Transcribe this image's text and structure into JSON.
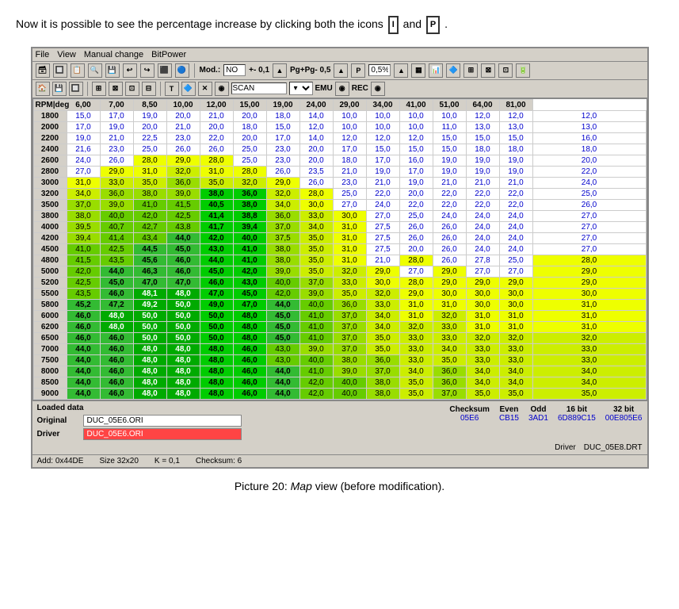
{
  "intro": {
    "text_before": "Now it is possible to see the percentage increase by clicking both the icons",
    "icon1": "I",
    "connector": "and",
    "icon2": "P",
    "text_after": "."
  },
  "window": {
    "menu": [
      "File",
      "View",
      "Manual change",
      "BitPower"
    ],
    "toolbar1": {
      "mod_label": "Mod.:",
      "mod_value": "NO",
      "plusminus_label": "+- 0,1",
      "pgpg_label": "Pg+Pg- 0,5",
      "percent_value": "0,5%"
    },
    "toolbar2": {
      "scan_label": "SCAN",
      "emu_label": "EMU",
      "rec_label": "REC"
    },
    "table": {
      "headers": [
        "RPM|deg",
        "6,00",
        "7,00",
        "8,50",
        "10,00",
        "12,00",
        "15,00",
        "19,00",
        "24,00",
        "29,00",
        "34,00",
        "41,00",
        "51,00",
        "64,00",
        "81,00"
      ],
      "rows": [
        {
          "rpm": "1800",
          "vals": [
            "15,0",
            "17,0",
            "19,0",
            "20,0",
            "21,0",
            "20,0",
            "18,0",
            "14,0",
            "10,0",
            "10,0",
            "10,0",
            "10,0",
            "12,0",
            "12,0",
            "12,0"
          ],
          "styles": [
            "",
            "",
            "",
            "",
            "",
            "",
            "",
            "",
            "",
            "",
            "",
            "",
            "",
            "",
            ""
          ]
        },
        {
          "rpm": "2000",
          "vals": [
            "17,0",
            "19,0",
            "20,0",
            "21,0",
            "20,0",
            "18,0",
            "15,0",
            "12,0",
            "10,0",
            "10,0",
            "10,0",
            "11,0",
            "13,0",
            "13,0",
            "13,0"
          ],
          "styles": [
            "",
            "",
            "",
            "",
            "",
            "",
            "",
            "",
            "",
            "",
            "",
            "",
            "",
            "",
            ""
          ]
        },
        {
          "rpm": "2200",
          "vals": [
            "19,0",
            "21,0",
            "22,5",
            "23,0",
            "22,0",
            "20,0",
            "17,0",
            "14,0",
            "12,0",
            "12,0",
            "12,0",
            "15,0",
            "15,0",
            "15,0",
            "16,0"
          ],
          "styles": [
            "",
            "",
            "",
            "",
            "",
            "",
            "",
            "",
            "",
            "",
            "",
            "",
            "",
            "",
            ""
          ]
        },
        {
          "rpm": "2400",
          "vals": [
            "21,6",
            "23,0",
            "25,0",
            "26,0",
            "26,0",
            "25,0",
            "23,0",
            "20,0",
            "17,0",
            "15,0",
            "15,0",
            "15,0",
            "18,0",
            "18,0",
            "18,0"
          ],
          "styles": [
            "",
            "",
            "",
            "",
            "",
            "",
            "",
            "",
            "",
            "",
            "",
            "",
            "",
            "",
            ""
          ]
        },
        {
          "rpm": "2600",
          "vals": [
            "24,0",
            "26,0",
            "28,0",
            "29,0",
            "28,0",
            "25,0",
            "23,0",
            "20,0",
            "18,0",
            "17,0",
            "16,0",
            "19,0",
            "19,0",
            "19,0",
            "20,0"
          ],
          "styles": [
            "",
            "",
            "",
            "",
            "",
            "",
            "",
            "",
            "",
            "",
            "",
            "",
            "",
            "",
            ""
          ]
        },
        {
          "rpm": "2800",
          "vals": [
            "27,0",
            "29,0",
            "31,0",
            "32,0",
            "31,0",
            "28,0",
            "26,0",
            "23,5",
            "21,0",
            "19,0",
            "17,0",
            "19,0",
            "19,0",
            "19,0",
            "22,0"
          ],
          "styles": [
            "",
            "",
            "",
            "",
            "",
            "",
            "",
            "",
            "",
            "",
            "",
            "",
            "",
            "",
            ""
          ]
        },
        {
          "rpm": "3000",
          "vals": [
            "31,0",
            "33,0",
            "35,0",
            "36,0",
            "35,0",
            "32,0",
            "29,0",
            "26,0",
            "23,0",
            "21,0",
            "19,0",
            "21,0",
            "21,0",
            "21,0",
            "24,0"
          ],
          "styles": [
            "",
            "",
            "",
            "",
            "",
            "",
            "",
            "",
            "",
            "",
            "",
            "",
            "",
            "",
            ""
          ]
        },
        {
          "rpm": "3200",
          "vals": [
            "34,0",
            "36,0",
            "38,0",
            "39,0",
            "38,0",
            "36,0",
            "32,0",
            "28,0",
            "25,0",
            "22,0",
            "20,0",
            "22,0",
            "22,0",
            "22,0",
            "25,0"
          ],
          "styles": [
            "",
            "",
            "",
            "",
            "g",
            "g",
            "",
            "",
            "",
            "",
            "",
            "",
            "",
            "",
            ""
          ]
        },
        {
          "rpm": "3500",
          "vals": [
            "37,0",
            "39,0",
            "41,0",
            "41,5",
            "40,5",
            "38,0",
            "34,0",
            "30,0",
            "27,0",
            "24,0",
            "22,0",
            "22,0",
            "22,0",
            "22,0",
            "26,0"
          ],
          "styles": [
            "",
            "",
            "",
            "",
            "g",
            "g",
            "",
            "",
            "",
            "",
            "",
            "",
            "",
            "",
            ""
          ]
        },
        {
          "rpm": "3800",
          "vals": [
            "38,0",
            "40,0",
            "42,0",
            "42,5",
            "41,4",
            "38,8",
            "36,0",
            "33,0",
            "30,0",
            "27,0",
            "25,0",
            "24,0",
            "24,0",
            "24,0",
            "27,0"
          ],
          "styles": [
            "",
            "",
            "",
            "",
            "g",
            "g",
            "",
            "",
            "",
            "",
            "",
            "",
            "",
            "",
            ""
          ]
        },
        {
          "rpm": "4000",
          "vals": [
            "39,5",
            "40,7",
            "42,7",
            "43,8",
            "41,7",
            "39,4",
            "37,0",
            "34,0",
            "31,0",
            "27,5",
            "26,0",
            "26,0",
            "24,0",
            "24,0",
            "27,0"
          ],
          "styles": [
            "",
            "",
            "",
            "",
            "g",
            "g",
            "",
            "",
            "",
            "",
            "",
            "",
            "",
            "",
            ""
          ]
        },
        {
          "rpm": "4200",
          "vals": [
            "39,4",
            "41,4",
            "43,4",
            "44,0",
            "42,0",
            "40,0",
            "37,5",
            "35,0",
            "31,0",
            "27,5",
            "26,0",
            "26,0",
            "24,0",
            "24,0",
            "27,0"
          ],
          "styles": [
            "",
            "",
            "",
            "",
            "g",
            "g",
            "",
            "",
            "",
            "",
            "",
            "",
            "",
            "",
            ""
          ]
        },
        {
          "rpm": "4500",
          "vals": [
            "41,0",
            "42,5",
            "44,5",
            "45,0",
            "43,0",
            "41,0",
            "38,0",
            "35,0",
            "31,0",
            "27,5",
            "20,0",
            "26,0",
            "24,0",
            "24,0",
            "27,0"
          ],
          "styles": [
            "",
            "",
            "",
            "",
            "g",
            "g",
            "",
            "",
            "",
            "",
            "",
            "",
            "",
            "",
            ""
          ]
        },
        {
          "rpm": "4800",
          "vals": [
            "41,5",
            "43,5",
            "45,6",
            "46,0",
            "44,0",
            "41,0",
            "38,0",
            "35,0",
            "31,0",
            "21,0",
            "28,0",
            "26,0",
            "27,8",
            "25,0",
            "28,0"
          ],
          "styles": [
            "",
            "",
            "",
            "",
            "g",
            "g",
            "",
            "",
            "",
            "",
            "",
            "",
            "",
            "",
            ""
          ]
        },
        {
          "rpm": "5000",
          "vals": [
            "42,0",
            "44,0",
            "46,3",
            "46,0",
            "45,0",
            "42,0",
            "39,0",
            "35,0",
            "32,0",
            "29,0",
            "27,0",
            "29,0",
            "27,0",
            "27,0",
            "29,0"
          ],
          "styles": [
            "",
            "",
            "",
            "",
            "g",
            "g",
            "",
            "",
            "",
            "",
            "",
            "",
            "",
            "",
            ""
          ]
        },
        {
          "rpm": "5200",
          "vals": [
            "42,5",
            "45,0",
            "47,0",
            "47,0",
            "46,0",
            "43,0",
            "40,0",
            "37,0",
            "33,0",
            "30,0",
            "28,0",
            "29,0",
            "29,0",
            "29,0",
            "29,0"
          ],
          "styles": [
            "",
            "",
            "",
            "",
            "g",
            "g",
            "",
            "",
            "",
            "",
            "",
            "",
            "",
            "",
            ""
          ]
        },
        {
          "rpm": "5500",
          "vals": [
            "43,5",
            "46,0",
            "48,1",
            "48,0",
            "47,0",
            "45,0",
            "42,0",
            "39,0",
            "35,0",
            "32,0",
            "29,0",
            "30,0",
            "30,0",
            "30,0",
            "30,0"
          ],
          "styles": [
            "",
            "",
            "",
            "",
            "g",
            "g",
            "",
            "",
            "",
            "",
            "",
            "",
            "",
            "",
            ""
          ]
        },
        {
          "rpm": "5800",
          "vals": [
            "45,2",
            "47,2",
            "49,2",
            "50,0",
            "49,0",
            "47,0",
            "44,0",
            "40,0",
            "36,0",
            "33,0",
            "31,0",
            "31,0",
            "30,0",
            "30,0",
            "31,0"
          ],
          "styles": [
            "",
            "",
            "",
            "",
            "g",
            "g",
            "",
            "",
            "",
            "",
            "",
            "",
            "",
            "",
            ""
          ]
        },
        {
          "rpm": "6000",
          "vals": [
            "46,0",
            "48,0",
            "50,0",
            "50,0",
            "50,0",
            "48,0",
            "45,0",
            "41,0",
            "37,0",
            "34,0",
            "31,0",
            "32,0",
            "31,0",
            "31,0",
            "31,0"
          ],
          "styles": [
            "",
            "",
            "",
            "",
            "g",
            "g",
            "",
            "",
            "",
            "",
            "",
            "",
            "",
            "",
            ""
          ]
        },
        {
          "rpm": "6200",
          "vals": [
            "46,0",
            "48,0",
            "50,0",
            "50,0",
            "50,0",
            "48,0",
            "45,0",
            "41,0",
            "37,0",
            "34,0",
            "32,0",
            "33,0",
            "31,0",
            "31,0",
            "31,0"
          ],
          "styles": [
            "",
            "",
            "",
            "",
            "g",
            "g",
            "",
            "",
            "",
            "",
            "",
            "",
            "",
            "",
            ""
          ]
        },
        {
          "rpm": "6500",
          "vals": [
            "46,0",
            "46,0",
            "50,0",
            "50,0",
            "50,0",
            "48,0",
            "45,0",
            "41,0",
            "37,0",
            "35,0",
            "33,0",
            "33,0",
            "32,0",
            "32,0",
            "32,0"
          ],
          "styles": [
            "",
            "",
            "",
            "",
            "g",
            "g",
            "",
            "",
            "",
            "",
            "",
            "",
            "",
            "",
            ""
          ]
        },
        {
          "rpm": "7000",
          "vals": [
            "44,0",
            "46,0",
            "48,0",
            "48,0",
            "48,0",
            "46,0",
            "43,0",
            "39,0",
            "37,0",
            "35,0",
            "33,0",
            "34,0",
            "33,0",
            "33,0",
            "33,0"
          ],
          "styles": [
            "",
            "",
            "",
            "",
            "g",
            "g",
            "",
            "",
            "",
            "",
            "",
            "",
            "",
            "",
            ""
          ]
        },
        {
          "rpm": "7500",
          "vals": [
            "44,0",
            "46,0",
            "48,0",
            "48,0",
            "48,0",
            "46,0",
            "43,0",
            "40,0",
            "38,0",
            "36,0",
            "33,0",
            "35,0",
            "33,0",
            "33,0",
            "33,0"
          ],
          "styles": [
            "",
            "",
            "",
            "",
            "g",
            "g",
            "",
            "",
            "",
            "",
            "",
            "",
            "",
            "",
            ""
          ]
        },
        {
          "rpm": "8000",
          "vals": [
            "44,0",
            "46,0",
            "48,0",
            "48,0",
            "48,0",
            "46,0",
            "44,0",
            "41,0",
            "39,0",
            "37,0",
            "34,0",
            "36,0",
            "34,0",
            "34,0",
            "34,0"
          ],
          "styles": [
            "",
            "",
            "",
            "",
            "g",
            "g",
            "",
            "",
            "",
            "",
            "",
            "",
            "",
            "",
            ""
          ]
        },
        {
          "rpm": "8500",
          "vals": [
            "44,0",
            "46,0",
            "48,0",
            "48,0",
            "48,0",
            "46,0",
            "44,0",
            "42,0",
            "40,0",
            "38,0",
            "35,0",
            "36,0",
            "34,0",
            "34,0",
            "34,0"
          ],
          "styles": [
            "",
            "",
            "",
            "",
            "g",
            "g",
            "",
            "",
            "",
            "",
            "",
            "",
            "",
            "",
            ""
          ]
        },
        {
          "rpm": "9000",
          "vals": [
            "44,0",
            "46,0",
            "48,0",
            "48,0",
            "48,0",
            "46,0",
            "44,0",
            "42,0",
            "40,0",
            "38,0",
            "35,0",
            "37,0",
            "35,0",
            "35,0",
            "35,0"
          ],
          "styles": [
            "",
            "",
            "",
            "",
            "g",
            "g",
            "",
            "",
            "",
            "",
            "",
            "",
            "",
            "",
            ""
          ]
        }
      ]
    },
    "loaded_data": {
      "title": "Loaded data",
      "original_label": "Original",
      "original_file": "DUC_05E6.ORI",
      "driver_label": "Driver",
      "driver_file": "DUC_05E6.ORI",
      "checksum_label": "Checksum",
      "even_label": "Even",
      "odd_label": "Odd",
      "bit16_label": "16 bit",
      "bit32_label": "32 bit",
      "checksum_val": "05E6",
      "even_val": "CB15",
      "odd_val": "3AD1",
      "bit16_val": "6D889C15",
      "bit32_val": "00E805E6",
      "driver_label2": "Driver",
      "driver_drt": "DUC_05E8.DRT",
      "addr": "Add: 0x44DE",
      "size": "Size 32x20",
      "k_val": "K = 0,1",
      "checksum2": "Checksum: 6"
    }
  },
  "caption": {
    "prefix": "Picture 20: ",
    "map_label": "Map",
    "suffix": " view (before modification)."
  }
}
